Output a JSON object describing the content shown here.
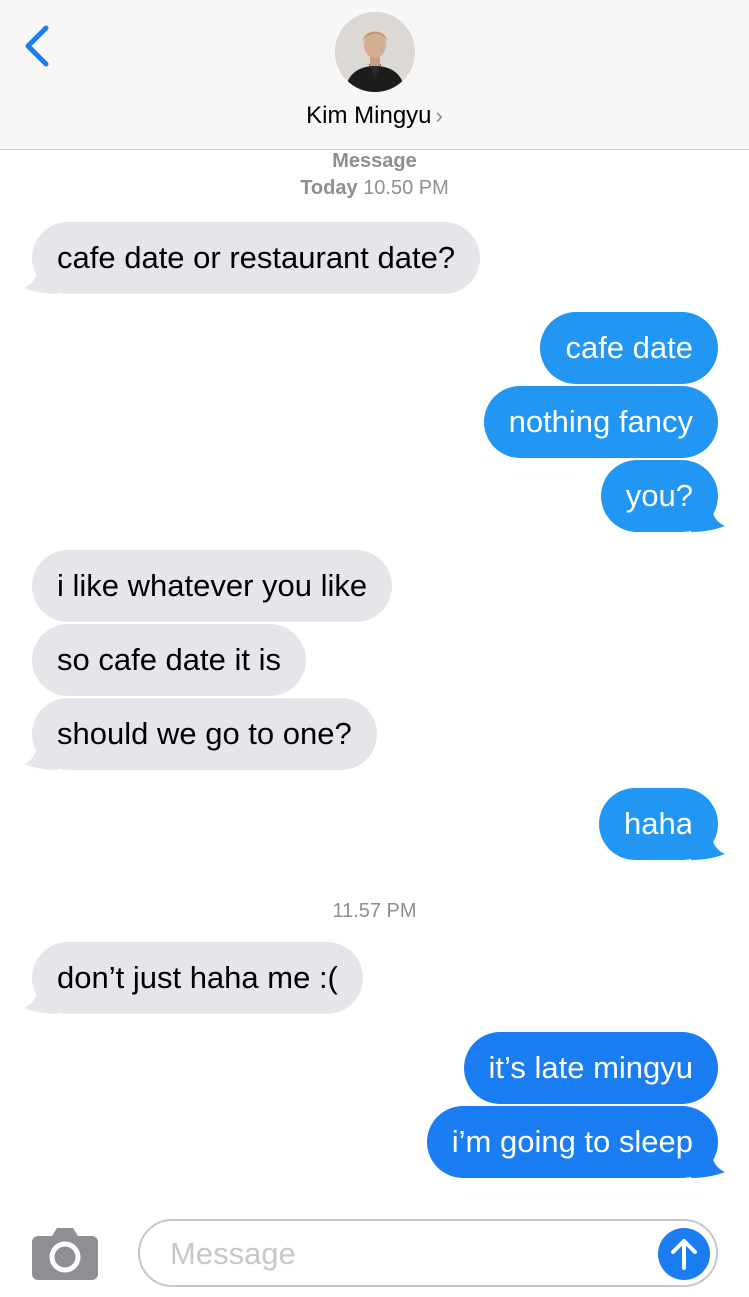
{
  "header": {
    "contact_name": "Kim Mingyu",
    "chevron": "›",
    "back_icon": "chevron-left-icon"
  },
  "conversation": {
    "service_label": "Message",
    "day_label": "Today",
    "first_time": "10.50 PM",
    "second_time": "11.57 PM"
  },
  "messages": [
    {
      "direction": "incoming",
      "text": "cafe date or restaurant date?"
    },
    {
      "direction": "outgoing",
      "text": "cafe date"
    },
    {
      "direction": "outgoing",
      "text": "nothing fancy"
    },
    {
      "direction": "outgoing",
      "text": "you?"
    },
    {
      "direction": "incoming",
      "text": "i like whatever you like"
    },
    {
      "direction": "incoming",
      "text": "so cafe date it is"
    },
    {
      "direction": "incoming",
      "text": "should we go to one?"
    },
    {
      "direction": "outgoing",
      "text": "haha"
    },
    {
      "direction": "incoming",
      "text": "don’t just haha me :("
    },
    {
      "direction": "outgoing",
      "text": "it’s late mingyu"
    },
    {
      "direction": "outgoing",
      "text": "i’m going to sleep"
    }
  ],
  "composer": {
    "placeholder": "Message",
    "value": "",
    "camera_icon": "camera-icon",
    "send_icon": "arrow-up-icon"
  },
  "colors": {
    "incoming_bubble": "#e5e5ea",
    "outgoing_imessage": "#2196f3",
    "outgoing_blue": "#1a7ef2",
    "accent": "#1a7ef2"
  }
}
